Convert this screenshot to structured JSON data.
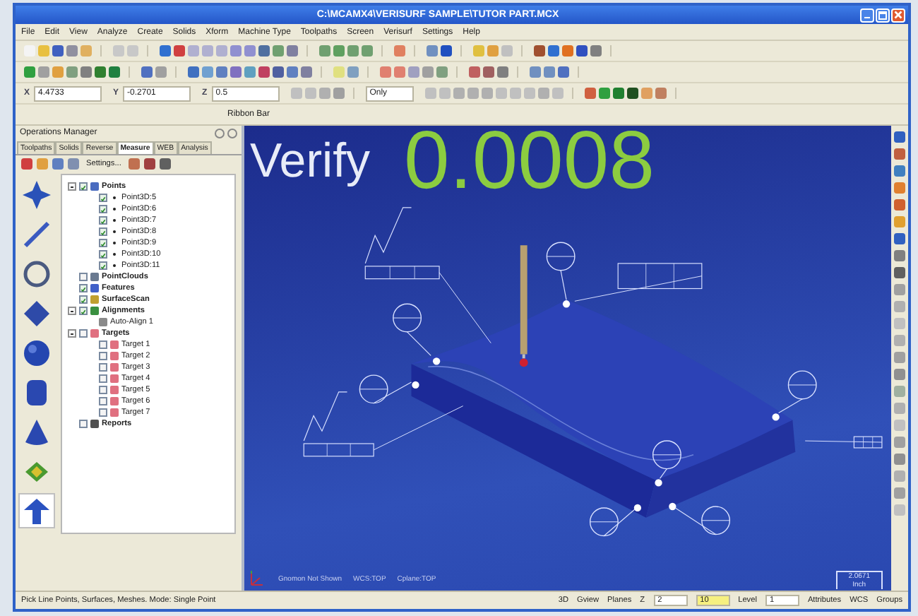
{
  "window": {
    "title": "C:\\MCAMX4\\VERISURF SAMPLE\\TUTOR PART.MCX"
  },
  "menu": [
    "File",
    "Edit",
    "View",
    "Analyze",
    "Create",
    "Solids",
    "Xform",
    "Machine Type",
    "Toolpaths",
    "Screen",
    "Verisurf",
    "Settings",
    "Help"
  ],
  "coordinates": [
    {
      "label": "X",
      "value": "4.4733"
    },
    {
      "label": "Y",
      "value": "-0.2701"
    },
    {
      "label": "Z",
      "value": "0.5"
    }
  ],
  "autocursor": {
    "value": "Only"
  },
  "ribbon_bar": {
    "label": "Ribbon Bar"
  },
  "operations_manager": {
    "title": "Operations Manager",
    "tabs": [
      {
        "label": "Toolpaths",
        "selected": false
      },
      {
        "label": "Solids",
        "selected": false
      },
      {
        "label": "Reverse",
        "selected": false
      },
      {
        "label": "Measure",
        "selected": true
      },
      {
        "label": "WEB",
        "selected": false
      },
      {
        "label": "Analysis",
        "selected": false
      }
    ],
    "settings_button": "Settings...",
    "shape_tools": [
      {
        "kind": "point",
        "selected": false
      },
      {
        "kind": "line",
        "selected": false
      },
      {
        "kind": "circle",
        "selected": false
      },
      {
        "kind": "plane",
        "selected": false
      },
      {
        "kind": "sphere",
        "selected": false
      },
      {
        "kind": "cylinder",
        "selected": false
      },
      {
        "kind": "cone",
        "selected": false
      },
      {
        "kind": "scan",
        "selected": false
      },
      {
        "kind": "vector",
        "selected": true
      }
    ],
    "tree": [
      {
        "label": "Points",
        "kind": "group",
        "checked": true,
        "expanded": true,
        "children": [
          {
            "label": "Point3D:5",
            "kind": "point",
            "checked": true
          },
          {
            "label": "Point3D:6",
            "kind": "point",
            "checked": true
          },
          {
            "label": "Point3D:7",
            "kind": "point",
            "checked": true
          },
          {
            "label": "Point3D:8",
            "kind": "point",
            "checked": true
          },
          {
            "label": "Point3D:9",
            "kind": "point",
            "checked": true
          },
          {
            "label": "Point3D:10",
            "kind": "point",
            "checked": true
          },
          {
            "label": "Point3D:11",
            "kind": "point",
            "checked": true
          }
        ]
      },
      {
        "label": "PointClouds",
        "kind": "cloud",
        "checked": false
      },
      {
        "label": "Features",
        "kind": "feature",
        "checked": true
      },
      {
        "label": "SurfaceScan",
        "kind": "scan",
        "checked": true
      },
      {
        "label": "Alignments",
        "kind": "alignment",
        "checked": true,
        "expanded": true,
        "children": [
          {
            "label": "Auto-Align 1",
            "kind": "align"
          }
        ]
      },
      {
        "label": "Targets",
        "kind": "target",
        "checked": false,
        "expanded": true,
        "children": [
          {
            "label": "Target 1",
            "kind": "target",
            "checked": false
          },
          {
            "label": "Target 2",
            "kind": "target",
            "checked": false
          },
          {
            "label": "Target 3",
            "kind": "target",
            "checked": false
          },
          {
            "label": "Target 4",
            "kind": "target",
            "checked": false
          },
          {
            "label": "Target 5",
            "kind": "target",
            "checked": false
          },
          {
            "label": "Target 6",
            "kind": "target",
            "checked": false
          },
          {
            "label": "Target 7",
            "kind": "target",
            "checked": false
          }
        ]
      },
      {
        "label": "Reports",
        "kind": "report",
        "checked": false
      }
    ]
  },
  "viewport": {
    "label": "Verify",
    "value": "0.0008",
    "info": [
      "Gnomon Not Shown",
      "WCS:TOP",
      "Cplane:TOP"
    ],
    "scale": {
      "value": "2.0671",
      "unit": "Inch"
    }
  },
  "status_bar": {
    "prompt": "Pick Line Points, Surfaces, Meshes. Mode: Single Point",
    "items": [
      {
        "kind": "label",
        "text": "3D"
      },
      {
        "kind": "label",
        "text": "Gview"
      },
      {
        "kind": "label",
        "text": "Planes"
      },
      {
        "kind": "label",
        "text": "Z"
      },
      {
        "kind": "field",
        "text": "2"
      },
      {
        "kind": "highlight",
        "text": "10"
      },
      {
        "kind": "label",
        "text": "Level"
      },
      {
        "kind": "field",
        "text": "1"
      },
      {
        "kind": "label",
        "text": "Attributes"
      },
      {
        "kind": "label",
        "text": "WCS"
      },
      {
        "kind": "label",
        "text": "Groups"
      }
    ]
  }
}
